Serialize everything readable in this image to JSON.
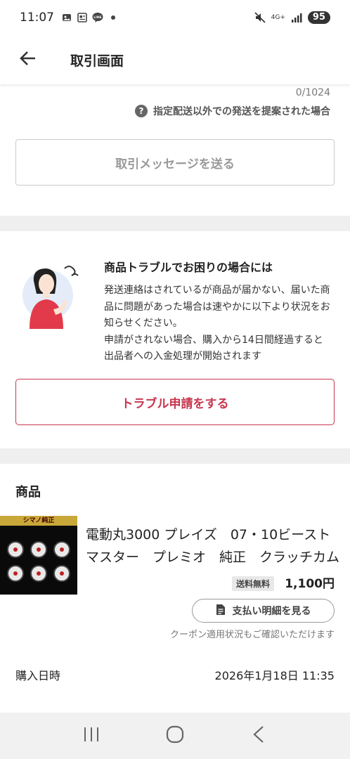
{
  "status_bar": {
    "time": "11:07",
    "network": "4G+",
    "battery": "95"
  },
  "header": {
    "title": "取引画面"
  },
  "message": {
    "char_count": "0/1024",
    "help_text": "指定配送以外での発送を提案された場合",
    "help_icon_glyph": "?",
    "send_label": "取引メッセージを送る"
  },
  "trouble": {
    "title": "商品トラブルでお困りの場合には",
    "body": "発送連絡はされているが商品が届かない、届いた商品に問題があった場合は速やかに以下より状況をお知らせください。\n申請がされない場合、購入から14日間経過すると出品者への入金処理が開始されます",
    "button_label": "トラブル申請をする",
    "accent_color": "#c8364f"
  },
  "product": {
    "section_heading": "商品",
    "thumbnail_banner": "シマノ純正",
    "title": "電動丸3000 プレイズ　07・10ビーストマスター　プレミオ　純正　クラッチカム",
    "shipping_badge": "送料無料",
    "price": "1,100円",
    "payment_button_label": "支払い明細を見る",
    "coupon_note": "クーポン適用状況もご確認いただけます"
  },
  "purchase": {
    "label": "購入日時",
    "value": "2026年1月18日 11:35"
  },
  "icons": {
    "back": "arrow-left-icon",
    "help": "question-circle-icon",
    "receipt": "document-icon",
    "nav_recent": "recent-apps-icon",
    "nav_home": "home-icon",
    "nav_back": "chevron-left-icon"
  }
}
